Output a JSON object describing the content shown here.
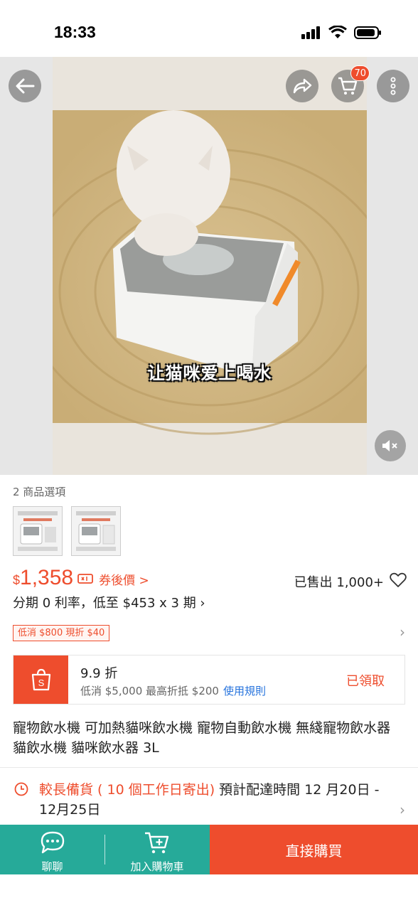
{
  "status_bar": {
    "time": "18:33"
  },
  "hero": {
    "caption": "让猫咪爱上喝水",
    "cart_badge_count": "70",
    "icons": [
      "back-arrow-icon",
      "share-icon",
      "cart-icon",
      "more-icon",
      "mute-icon"
    ]
  },
  "options": {
    "label": "2 商品選項",
    "count": 2
  },
  "price": {
    "currency": "$",
    "value": "1,358",
    "coupon_label": "券後價 >",
    "sold": "已售出 1,000+",
    "installment": "分期 0 利率，低至 $453 x 3 期 ›"
  },
  "voucher_tag": "低消 $800 現折 $40",
  "shop_voucher": {
    "title": "9.9 折",
    "subtitle": "低消 $5,000 最高折抵 $200",
    "rule_link": "使用規則",
    "status": "已領取"
  },
  "product_title": "寵物飲水機 可加熱貓咪飲水機 寵物自動飲水機 無綫寵物飲水器 貓飲水機 貓咪飲水器 3L",
  "shipping": {
    "highlight": "較長備貨 ( 10 個工作日寄出)",
    "text": " 預計配達時間 12 月20日 - 12月25日"
  },
  "bottom_bar": {
    "chat_label": "聊聊",
    "add_to_cart_label": "加入購物車",
    "buy_now_label": "直接購買"
  },
  "colors": {
    "accent": "#ee4d2d",
    "secondary": "#26aa99",
    "link": "#2673dd"
  }
}
